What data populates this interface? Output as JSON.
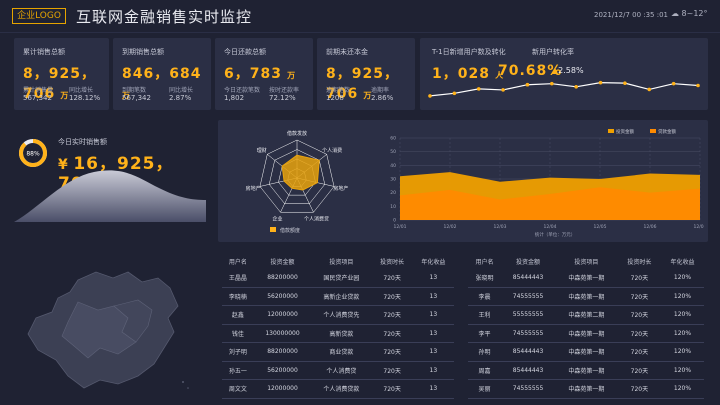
{
  "header": {
    "logo": "企业LOGO",
    "title": "互联网金融销售实时监控",
    "datetime": "2021/12/7 00 :35 :01",
    "weather": "8~12°"
  },
  "stats": [
    {
      "label": "累计销售总额",
      "value": "8，925，706",
      "unit": "万",
      "sub": [
        {
          "label": "累计销售量",
          "value": "567,342"
        },
        {
          "label": "同比增长",
          "value": "128.12%"
        }
      ]
    },
    {
      "label": "到期销售总额",
      "value": "846，684",
      "unit": "万",
      "sub": [
        {
          "label": "到期笔数",
          "value": "567,342"
        },
        {
          "label": "同比增长",
          "value": "2.87%"
        }
      ]
    },
    {
      "label": "今日还款总额",
      "value": "6，783",
      "unit": "万",
      "sub": [
        {
          "label": "今日还款笔数",
          "value": "1,802"
        },
        {
          "label": "按时还款率",
          "value": "72.12%"
        }
      ]
    },
    {
      "label": "前期未还本金",
      "value": "8，925，706",
      "unit": "万",
      "sub": [
        {
          "label": "逾期笔数",
          "value": "1208"
        },
        {
          "label": "逾期率",
          "value": "2.86%"
        }
      ]
    }
  ],
  "users": {
    "label1": "T-1日新增用户数及转化",
    "label2": "新用户转化率",
    "count": "1，028",
    "count_unit": "人",
    "rate": "70.68%",
    "change": "2.58%",
    "line": [
      35,
      45,
      62,
      58,
      78,
      82,
      70,
      86,
      84,
      60,
      82,
      75
    ]
  },
  "realtime": {
    "label": "今日实时销售额",
    "percent": "88%",
    "currency": "¥",
    "value": "16，925，703",
    "unit": "万"
  },
  "radar": {
    "axes": [
      "借款发放",
      "个人消费",
      "房地产",
      "个人消费贷",
      "企业",
      "房地产1",
      "理财"
    ],
    "axis_labels": [
      "借款发放",
      "个人消费",
      "房地产",
      "个人消费贷",
      "企业",
      "房地产",
      "理财"
    ],
    "values": [
      0.6,
      0.75,
      0.55,
      0.35,
      0.3,
      0.35,
      0.5
    ],
    "legend": "借款额度"
  },
  "chart_data": {
    "type": "area",
    "x": [
      "12/01",
      "12/02",
      "12/03",
      "12/04",
      "12/05",
      "12/06",
      "12/07"
    ],
    "xlabel": "统计（单位：万元）",
    "ylim": [
      0,
      60
    ],
    "yticks": [
      "0",
      "10",
      "20",
      "30",
      "40",
      "50",
      "60"
    ],
    "series": [
      {
        "name": "投资金额",
        "color": "#f0a000",
        "values": [
          32,
          35,
          28,
          31,
          30,
          34,
          33
        ]
      },
      {
        "name": "贷款金额",
        "color": "#ff8a00",
        "values": [
          18,
          22,
          15,
          19,
          24,
          20,
          23
        ]
      }
    ]
  },
  "table_left": {
    "headers": [
      "用户名",
      "投资金额",
      "投资项目",
      "投资时长",
      "年化收益"
    ],
    "rows": [
      [
        "王晶晶",
        "88200000",
        "国民贷产业园",
        "720天",
        "13"
      ],
      [
        "李晓楠",
        "56200000",
        "高新企业贷款",
        "720天",
        "13"
      ],
      [
        "赵鑫",
        "12000000",
        "个人消费贷先",
        "720天",
        "13"
      ],
      [
        "钱佳",
        "130000000",
        "高新贷款",
        "720天",
        "13"
      ],
      [
        "刘子明",
        "88200000",
        "商业贷款",
        "720天",
        "13"
      ],
      [
        "孙五一",
        "56200000",
        "个人消费贷",
        "720天",
        "13"
      ],
      [
        "周文文",
        "12000000",
        "个人消费贷款",
        "720天",
        "13"
      ]
    ]
  },
  "table_right": {
    "headers": [
      "用户名",
      "投资金额",
      "投资项目",
      "投资时长",
      "年化收益"
    ],
    "rows": [
      [
        "张晓明",
        "85444443",
        "中森苑第一期",
        "720天",
        "120%"
      ],
      [
        "李晨",
        "74555555",
        "中森苑第一期",
        "720天",
        "120%"
      ],
      [
        "王利",
        "55555555",
        "中森苑第二期",
        "720天",
        "120%"
      ],
      [
        "李平",
        "74555555",
        "中森苑第一期",
        "720天",
        "120%"
      ],
      [
        "孙明",
        "85444443",
        "中森苑第一期",
        "720天",
        "120%"
      ],
      [
        "周嘉",
        "85444443",
        "中森苑第一期",
        "720天",
        "120%"
      ],
      [
        "吴丽",
        "74555555",
        "中森苑第一期",
        "720天",
        "120%"
      ]
    ]
  }
}
